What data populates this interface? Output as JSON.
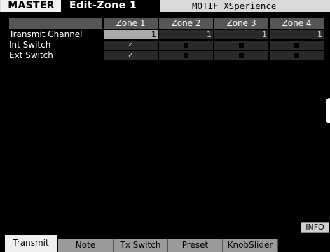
{
  "header": {
    "mode": "MASTER",
    "screen": "Edit-Zone 1",
    "name": "MOTIF XSperience"
  },
  "table": {
    "zones": [
      "Zone 1",
      "Zone 2",
      "Zone 3",
      "Zone 4"
    ],
    "rows": [
      {
        "label": "Transmit Channel",
        "values": [
          "1",
          "1",
          "1",
          "1"
        ]
      },
      {
        "label": "Int Switch",
        "values": [
          "on",
          "off",
          "off",
          "off"
        ]
      },
      {
        "label": "Ext Switch",
        "values": [
          "on",
          "off",
          "off",
          "off"
        ]
      }
    ]
  },
  "info_label": "INFO",
  "tabs": [
    "Transmit",
    "Note",
    "Tx Switch",
    "Preset",
    "KnobSlider"
  ],
  "active_tab": "Transmit",
  "check_glyph": "✓"
}
